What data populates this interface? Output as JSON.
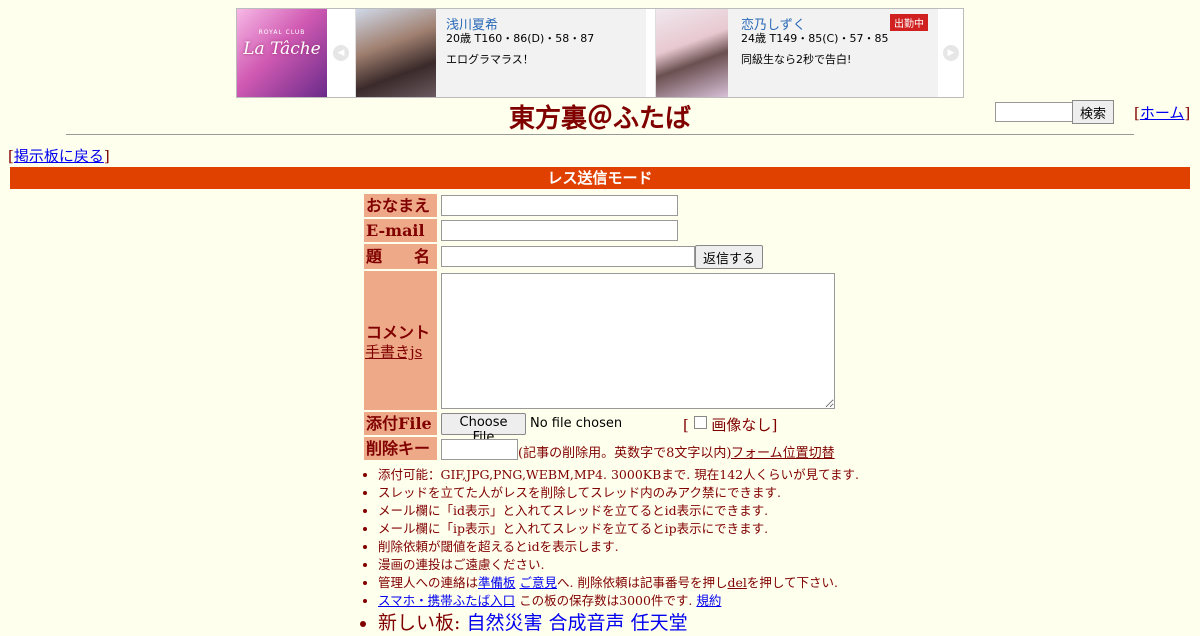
{
  "ad": {
    "logo_small": "ROYAL CLUB",
    "logo_big": "La Tâche",
    "prev_icon": "chevron-left-icon",
    "next_icon": "chevron-right-icon",
    "cards": [
      {
        "name": "浅川夏希",
        "stats": "20歳 T160・86(D)・58・87",
        "message": "エログラマラス！",
        "badge": ""
      },
      {
        "name": "恋乃しずく",
        "stats": "24歳 T149・85(C)・57・85",
        "message": "同級生なら2秒で告白!",
        "badge": "出勤中"
      }
    ]
  },
  "header": {
    "title": "東方裏＠ふたば",
    "search_button": "検索",
    "home_bracket_open": "[",
    "home_label": "ホーム",
    "home_bracket_close": "]"
  },
  "back": {
    "open": "[",
    "label": "掲示板に戻る",
    "close": "]"
  },
  "mode_title": "レス送信モード",
  "form": {
    "name_label": "おなまえ",
    "email_label": "E-mail",
    "subject_label": "題　　名",
    "submit_label": "返信する",
    "comment_label": "コメント",
    "handwrite_link": "手書きjs",
    "file_label": "添付File",
    "file_button": "Choose File",
    "file_status": "No file chosen",
    "noimage_open": "[",
    "noimage_label": "画像なし",
    "noimage_close": "]",
    "delkey_label": "削除キー",
    "delkey_note": "(記事の削除用。英数字で8文字以内)",
    "position_link": "フォーム位置切替"
  },
  "notes": {
    "n1": "添付可能：GIF,JPG,PNG,WEBM,MP4. 3000KBまで. 現在142人くらいが見てます.",
    "n2": "スレッドを立てた人がレスを削除してスレッド内のみアク禁にできます.",
    "n3": "メール欄に「id表示」と入れてスレッドを立てるとid表示にできます.",
    "n4": "メール欄に「ip表示」と入れてスレッドを立てるとip表示にできます.",
    "n5": "削除依頼が閾値を超えるとidを表示します.",
    "n6": "漫画の連投はご遠慮ください.",
    "n7_prefix": "管理人への連絡は",
    "n7_link1": "準備板",
    "n7_link2": "ご意見",
    "n7_middle": "へ. 削除依頼は記事番号を押し",
    "n7_del": "del",
    "n7_suffix": "を押して下さい.",
    "n8_link": "スマホ・携帯ふたば入口",
    "n8_text": " この板の保存数は3000件です.",
    "n8_rules": "規約",
    "n9_label": "新しい板:",
    "n9_links": [
      "自然災害",
      "合成音声",
      "任天堂"
    ]
  },
  "colors": {
    "background": "#ffffee",
    "text": "#800000",
    "label_bg": "#eeaa88",
    "mode_bar": "#e04000",
    "link": "#0000ee"
  }
}
